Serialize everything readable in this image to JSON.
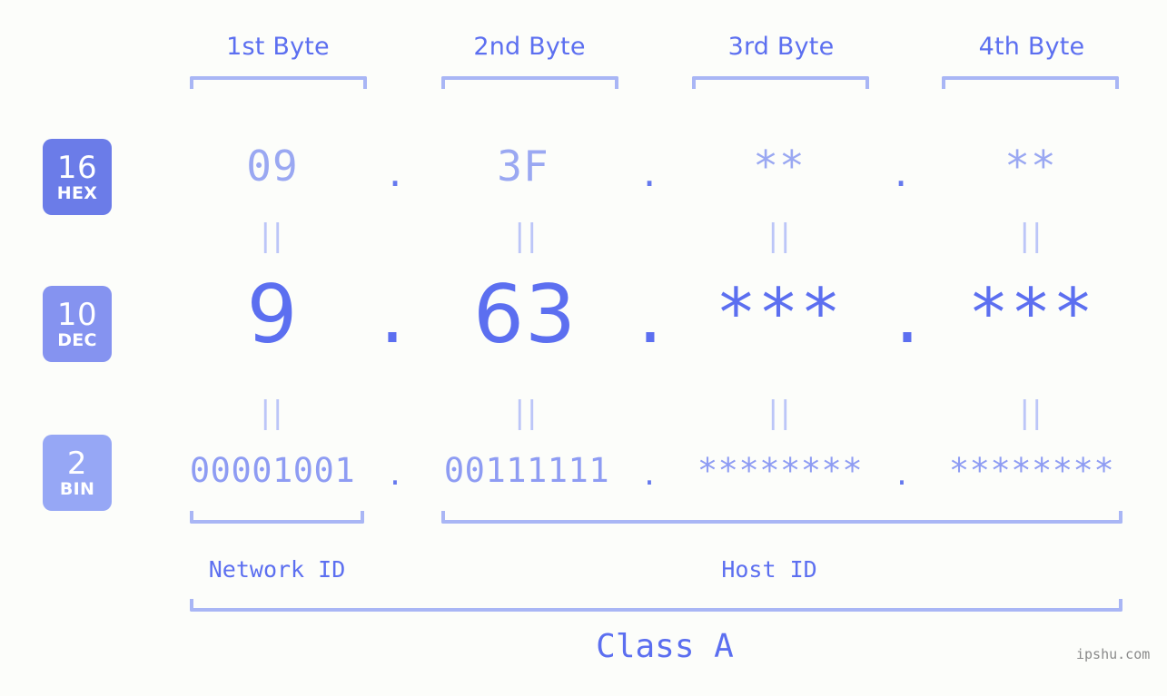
{
  "background_color": "#fcfdfa",
  "accent_color": "#5c6ff0",
  "accent_light_color": "#a9b6f5",
  "byte_headers": [
    {
      "label": "1st Byte"
    },
    {
      "label": "2nd Byte"
    },
    {
      "label": "3rd Byte"
    },
    {
      "label": "4th Byte"
    }
  ],
  "bases": [
    {
      "number": "16",
      "name": "HEX",
      "badge_color": "#6b7ce8"
    },
    {
      "number": "10",
      "name": "DEC",
      "badge_color": "#8593f0"
    },
    {
      "number": "2",
      "name": "BIN",
      "badge_color": "#96a7f5"
    }
  ],
  "rows": {
    "hex": {
      "base_number": "16",
      "base_name": "HEX",
      "values": [
        "09",
        "3F",
        "**",
        "**"
      ],
      "separator": "."
    },
    "dec": {
      "base_number": "10",
      "base_name": "DEC",
      "values": [
        "9",
        "63",
        "***",
        "***"
      ],
      "separator": "."
    },
    "bin": {
      "base_number": "2",
      "base_name": "BIN",
      "values": [
        "00001001",
        "00111111",
        "********",
        "********"
      ],
      "separator": "."
    }
  },
  "equals_marks": {
    "glyph": "||",
    "count_per_row": 4
  },
  "segments": {
    "network_id": "Network ID",
    "host_id": "Host ID",
    "class": "Class A"
  },
  "watermark": "ipshu.com"
}
